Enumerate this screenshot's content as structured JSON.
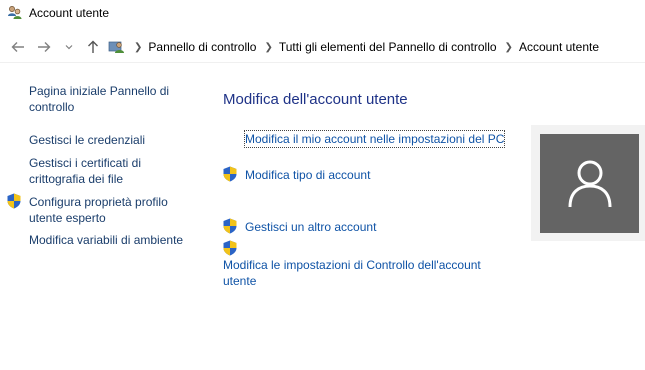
{
  "window": {
    "title": "Account utente",
    "icon": "user-accounts-icon"
  },
  "nav": {
    "back_icon": "back-arrow-icon",
    "forward_icon": "forward-arrow-icon",
    "recent_icon": "chevron-down-icon",
    "up_icon": "up-arrow-icon"
  },
  "breadcrumb": [
    {
      "label": "Pannello di controllo"
    },
    {
      "label": "Tutti gli elementi del Pannello di controllo"
    },
    {
      "label": "Account utente"
    }
  ],
  "sidebar": {
    "items": [
      {
        "label": "Pagina iniziale Pannello di controllo",
        "shield": false
      },
      {
        "label": "Gestisci le credenziali",
        "shield": false
      },
      {
        "label": "Gestisci i certificati di crittografia dei file",
        "shield": false
      },
      {
        "label": "Configura proprietà profilo utente esperto",
        "shield": true
      },
      {
        "label": "Modifica variabili di ambiente",
        "shield": false
      }
    ]
  },
  "main": {
    "title": "Modifica dell'account utente",
    "links": [
      {
        "label": "Modifica il mio account nelle impostazioni del PC",
        "shield": false
      },
      {
        "label": "Modifica tipo di account",
        "shield": true
      },
      {
        "label": "Gestisci un altro account",
        "shield": true
      },
      {
        "label": "Modifica le impostazioni di Controllo dell'account utente",
        "shield": true
      }
    ]
  },
  "avatar": {
    "icon": "user-avatar-icon"
  },
  "colors": {
    "link": "#0f53a6",
    "sidebar_link": "#1a3d6b",
    "title": "#1e3287",
    "avatar_bg": "#646464",
    "avatar_frame": "#f2f2f2"
  }
}
